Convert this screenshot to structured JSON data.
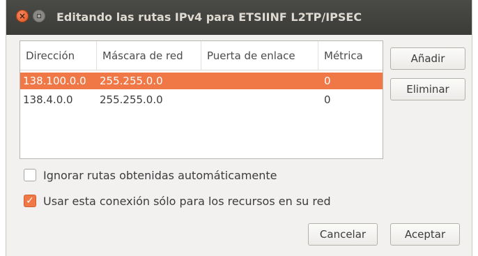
{
  "window": {
    "title": "Editando las rutas IPv4 para ETSIINF L2TP/IPSEC",
    "close_glyph": "×"
  },
  "table": {
    "columns": [
      "Dirección",
      "Máscara de red",
      "Puerta de enlace",
      "Métrica"
    ],
    "rows": [
      {
        "address": "138.100.0.0",
        "netmask": "255.255.0.0",
        "gateway": "",
        "metric": "0",
        "selected": true
      },
      {
        "address": "138.4.0.0",
        "netmask": "255.255.0.0",
        "gateway": "",
        "metric": "0",
        "selected": false
      }
    ]
  },
  "side_buttons": {
    "add": "Añadir",
    "remove": "Eliminar"
  },
  "options": {
    "ignore_auto_routes": {
      "label": "Ignorar rutas obtenidas automáticamente",
      "checked": false
    },
    "use_only_for_network": {
      "label": "Usar esta conexión sólo para los recursos en su red",
      "checked": true,
      "check_glyph": "✓"
    }
  },
  "footer": {
    "cancel": "Cancelar",
    "accept": "Aceptar"
  },
  "colors": {
    "accent": "#f07746",
    "titlebar": "#3c3b37",
    "window_bg": "#f2f1f0"
  }
}
